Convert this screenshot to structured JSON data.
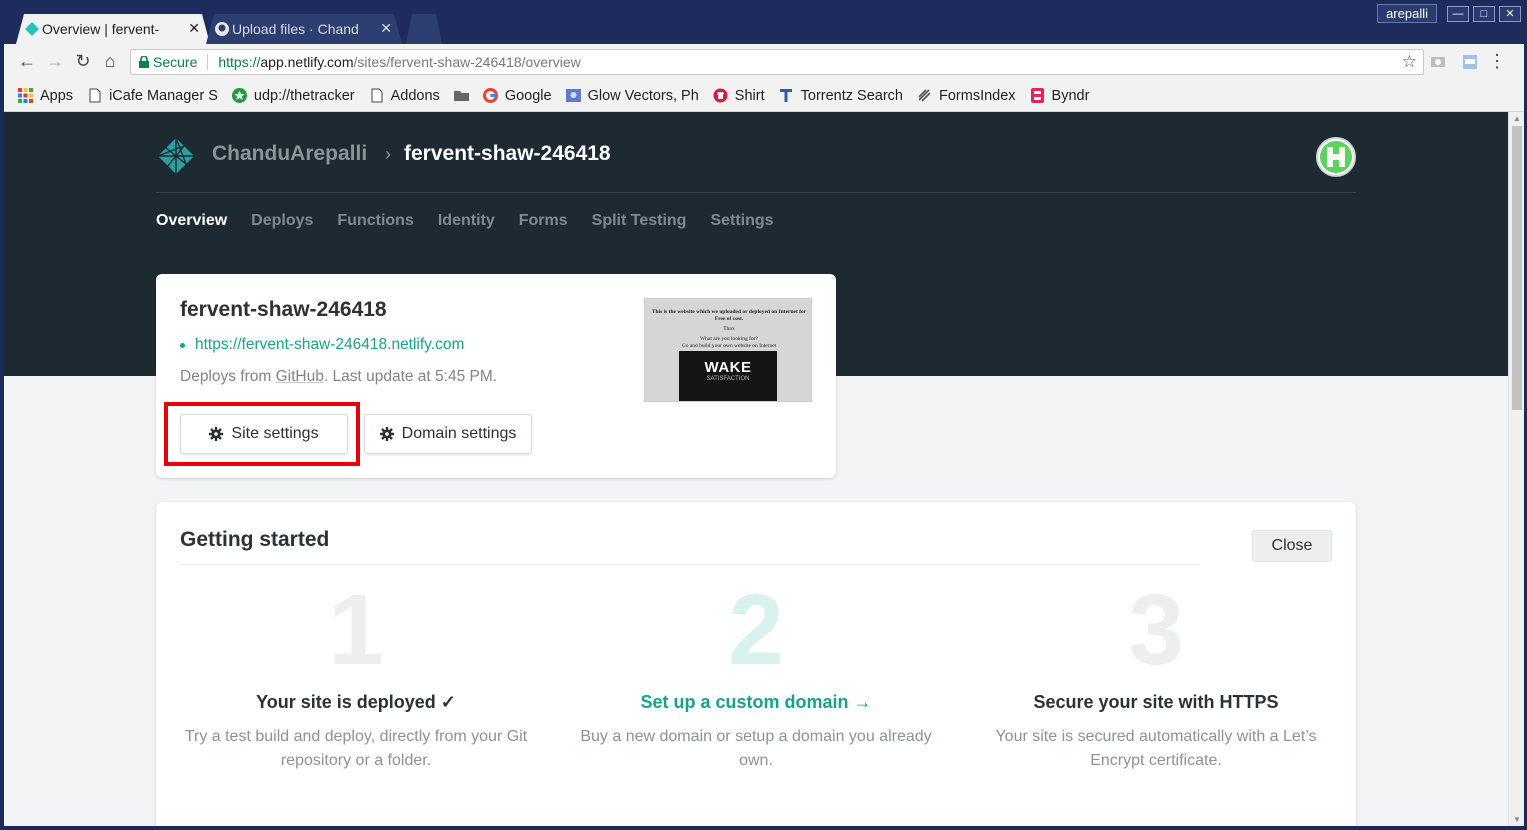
{
  "browser": {
    "tabs": [
      {
        "title": "Overview | fervent-",
        "active": true
      },
      {
        "title": "Upload files · Chand",
        "active": false
      }
    ],
    "window_user": "arepalli",
    "secure_label": "Secure",
    "url": {
      "scheme": "https://",
      "host": "app.netlify.com",
      "path": "/sites/fervent-shaw-246418/overview"
    },
    "bookmarks": [
      {
        "label": "Apps",
        "icon": "apps-grid-icon"
      },
      {
        "label": "iCafe Manager S",
        "icon": "page-icon"
      },
      {
        "label": "udp://thetracker",
        "icon": "green-star-icon"
      },
      {
        "label": "Addons",
        "icon": "page-icon"
      },
      {
        "label": "",
        "icon": "folder-icon"
      },
      {
        "label": "Google",
        "icon": "google-icon"
      },
      {
        "label": "Glow Vectors, Ph",
        "icon": "image-icon"
      },
      {
        "label": "Shirt",
        "icon": "shirt-icon"
      },
      {
        "label": "Torrentz Search",
        "icon": "torrentz-icon"
      },
      {
        "label": "FormsIndex",
        "icon": "forms-icon"
      },
      {
        "label": "Byndr",
        "icon": "byndr-icon"
      }
    ]
  },
  "header": {
    "team": "ChanduArepalli",
    "separator": "›",
    "site": "fervent-shaw-246418"
  },
  "subnav": [
    "Overview",
    "Deploys",
    "Functions",
    "Identity",
    "Forms",
    "Split Testing",
    "Settings"
  ],
  "site_card": {
    "title": "fervent-shaw-246418",
    "url": "https://fervent-shaw-246418.netlify.com",
    "deploy_prefix": "Deploys from ",
    "deploy_source": "GitHub",
    "deploy_suffix": ". Last update at 5:45 PM.",
    "site_settings": "Site settings",
    "domain_settings": "Domain settings",
    "preview": {
      "line1": "This is the website which we uploaded or deployed on Internet for Free of cost.",
      "line2": "Thnx",
      "line3": "What are you looking for?",
      "line4": "Go and build your own website on Internet",
      "image_title": "WAKE",
      "image_sub": "SATISFACTION"
    }
  },
  "getting_started": {
    "title": "Getting started",
    "close": "Close",
    "steps": [
      {
        "num": "1",
        "title": "Your site is deployed ✓",
        "desc": "Try a test build and deploy, directly from your Git repository or a folder."
      },
      {
        "num": "2",
        "title": "Set up a custom domain  →",
        "desc": "Buy a new domain or setup a domain you already own."
      },
      {
        "num": "3",
        "title": "Secure your site with HTTPS",
        "desc": "Your site is secured automatically with a Let’s Encrypt certificate."
      }
    ]
  },
  "colors": {
    "accent": "#19a28b",
    "hero_bg": "#1e2a32",
    "highlight": "#e8000c"
  }
}
